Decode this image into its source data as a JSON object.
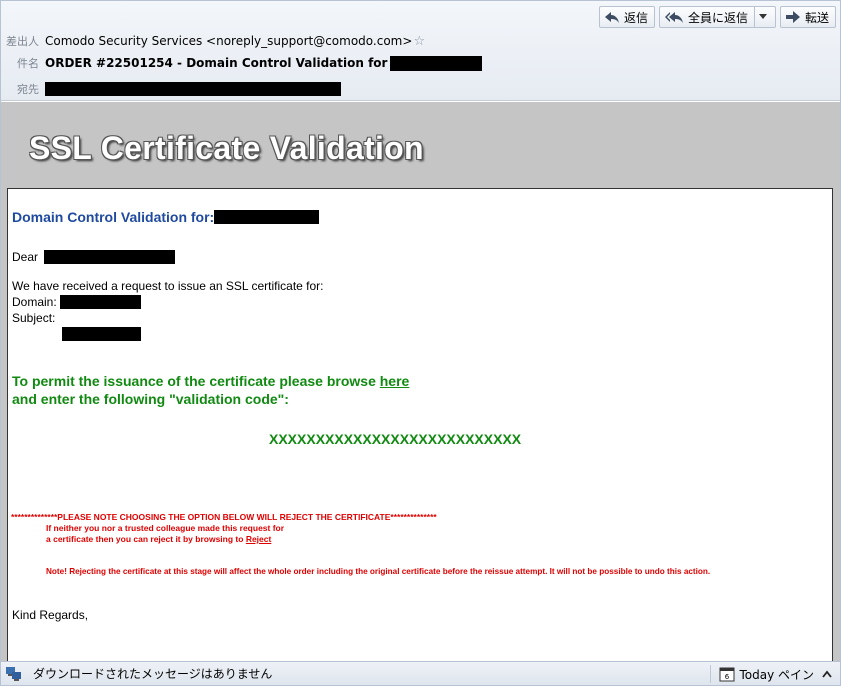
{
  "header": {
    "from_label": "差出人",
    "from_value": "Comodo Security Services <noreply_support@comodo.com>",
    "subject_label": "件名",
    "subject_value": "ORDER #22501254 - Domain Control Validation for",
    "to_label": "宛先",
    "star_icon": "star-icon"
  },
  "actions": {
    "reply": "返信",
    "reply_all": "全員に返信",
    "forward": "転送"
  },
  "banner": {
    "title": "SSL Certificate Validation"
  },
  "body": {
    "dcv_title": "Domain Control Validation for:",
    "dear": "Dear",
    "received": "We have received a request to issue an SSL certificate for:",
    "domain_label": "Domain:",
    "subject_label": "Subject:",
    "permit_line1": "To permit the issuance of the certificate please browse",
    "here_link": "here",
    "permit_line2": "and enter the following \"validation code\":",
    "validation_code": "XXXXXXXXXXXXXXXXXXXXXXXXXXX",
    "note_line": "**************PLEASE NOTE CHOOSING THE OPTION BELOW WILL REJECT THE CERTIFICATE**************",
    "neither_line1": "If neither you nor a trusted colleague made this request for",
    "neither_line2": "a certificate then you can reject it by browsing to",
    "reject_link": "Reject",
    "warning": "Note! Rejecting the certificate at this stage will affect the whole order including the original certificate before the reissue attempt. It will not be possible to undo this action.",
    "regards": "Kind Regards,"
  },
  "status": {
    "message": "ダウンロードされたメッセージはありません",
    "today_pane": "Today ペイン"
  },
  "colors": {
    "dcv_blue": "#1f4aa0",
    "green": "#118a11",
    "red": "#e00000",
    "banner_gray": "#c5c5c5"
  }
}
